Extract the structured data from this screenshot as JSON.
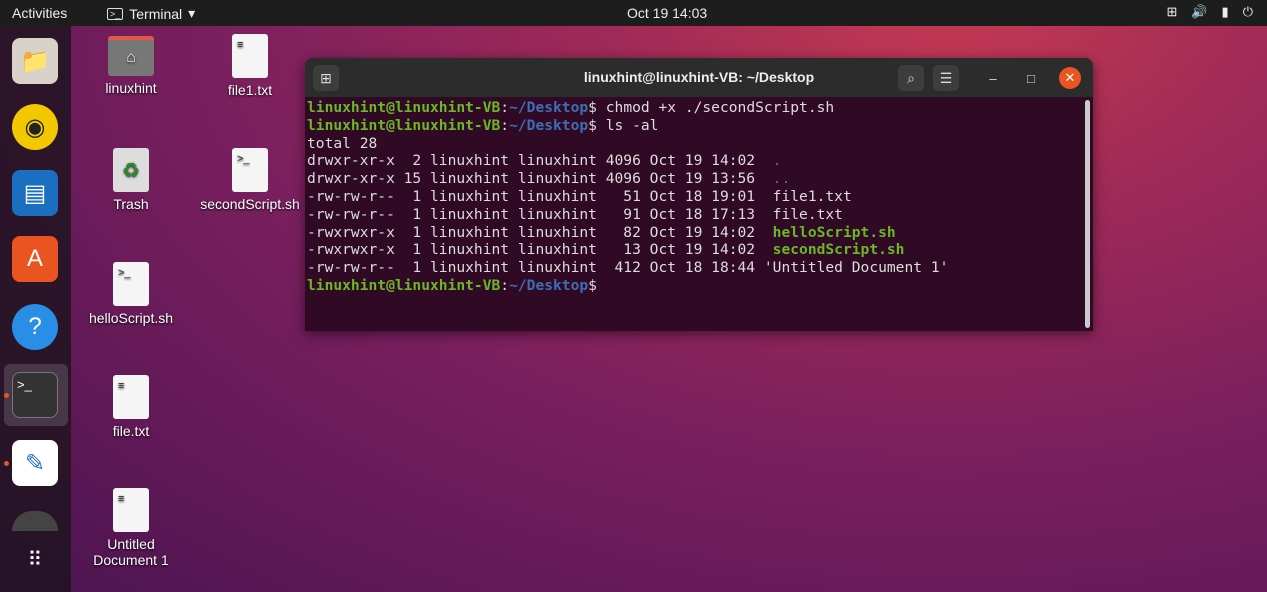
{
  "topbar": {
    "activities": "Activities",
    "app_menu": "Terminal",
    "clock": "Oct 19  14:03"
  },
  "desktop": {
    "icons": [
      "linuxhint",
      "file1.txt",
      "Trash",
      "secondScript.sh",
      "helloScript.sh",
      "file.txt",
      "Untitled Document 1"
    ]
  },
  "terminal": {
    "title": "linuxhint@linuxhint-VB: ~/Desktop",
    "prompt_user": "linuxhint@linuxhint-VB",
    "prompt_path": "~/Desktop",
    "commands": [
      "chmod +x ./secondScript.sh",
      "ls -al"
    ],
    "total": "total 28",
    "rows": [
      {
        "meta": "drwxr-xr-x  2 linuxhint linuxhint 4096 Oct 19 14:02  ",
        "name": ".",
        "kind": "dir"
      },
      {
        "meta": "drwxr-xr-x 15 linuxhint linuxhint 4096 Oct 19 13:56  ",
        "name": "..",
        "kind": "dir"
      },
      {
        "meta": "-rw-rw-r--  1 linuxhint linuxhint   51 Oct 18 19:01  ",
        "name": "file1.txt",
        "kind": "file"
      },
      {
        "meta": "-rw-rw-r--  1 linuxhint linuxhint   91 Oct 18 17:13  ",
        "name": "file.txt",
        "kind": "file"
      },
      {
        "meta": "-rwxrwxr-x  1 linuxhint linuxhint   82 Oct 19 14:02  ",
        "name": "helloScript.sh",
        "kind": "exec"
      },
      {
        "meta": "-rwxrwxr-x  1 linuxhint linuxhint   13 Oct 19 14:02  ",
        "name": "secondScript.sh",
        "kind": "exec"
      },
      {
        "meta": "-rw-rw-r--  1 linuxhint linuxhint  412 Oct 18 18:44 ",
        "name": "'Untitled Document 1'",
        "kind": "file"
      }
    ]
  }
}
